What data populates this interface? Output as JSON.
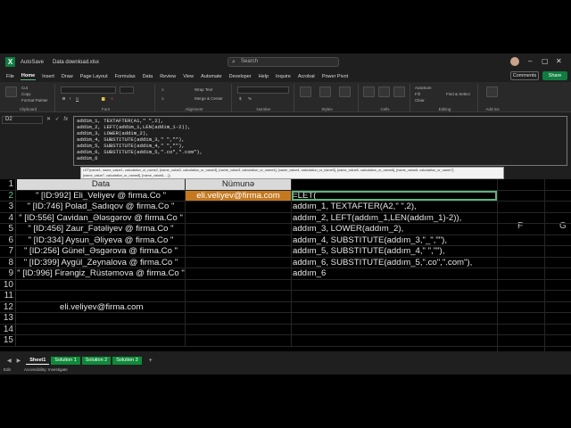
{
  "window": {
    "autosave": "AutoSave",
    "filename": "Data download.xlsx",
    "search_placeholder": "Search",
    "search_icon": "search-icon"
  },
  "menu": {
    "tabs": [
      "File",
      "Home",
      "Insert",
      "Draw",
      "Page Layout",
      "Formulas",
      "Data",
      "Review",
      "View",
      "Automate",
      "Developer",
      "Help",
      "Inquire",
      "Acrobat",
      "Power Pivot"
    ],
    "active": "Home",
    "comments_label": "Comments",
    "share_label": "Share"
  },
  "ribbon": {
    "clipboard": {
      "label": "Clipboard",
      "cut": "Cut",
      "copy": "Copy",
      "format_painter": "Format Painter"
    },
    "font": {
      "label": "Font"
    },
    "alignment": {
      "label": "Alignment",
      "wrap_text": "Wrap Text",
      "merge_center": "Merge & Center"
    },
    "number": {
      "label": "Number"
    },
    "styles": {
      "label": "Styles",
      "conditional": "Conditional Formatting",
      "format_table": "Format as Table",
      "cell_styles": "Cell Styles"
    },
    "cells": {
      "label": "Cells",
      "insert": "Insert",
      "delete": "Delete",
      "format": "Format"
    },
    "editing": {
      "label": "Editing",
      "autosum": "AutoSum",
      "fill": "Fill",
      "clear": "Clear",
      "sort": "Sort & Filter",
      "find": "Find & Select"
    },
    "addins": {
      "label": "Add-ins"
    }
  },
  "formula_bar": {
    "name_box": "D2",
    "formula_lines": [
      "addim_1, TEXTAFTER(A1,\" \",2),",
      "addim_2, LEFT(addim_1,LEN(addim_1-2)),",
      "addim_3, LOWER(addim_2),",
      "addim_4, SUBSTITUTE(addim_3,\" \",\"\"),",
      "addim_5, SUBSTITUTE(addim_4,\" \",\"\"),",
      "addim_6, SUBSTITUTE(addim_5,\".co\",\".com\"),",
      "addim_6"
    ],
    "tooltip_line1": "LET(name1, name_value1, calculation_or_name2, [name_value2, calculation_or_name3], [name_value3, calculation_or_name4], [name_value4, calculation_or_name5], [name_value5, calculation_or_name6], [name_value6, calculation_or_name7]",
    "tooltip_line2": "[name_value7, calculation_or_name8], [name_value8, ...])"
  },
  "grid": {
    "column_headers": {
      "F": "F",
      "G": "G"
    },
    "rows": [
      {
        "num": "1",
        "a": "Data",
        "b": "Nümunə",
        "c": ""
      },
      {
        "num": "2",
        "a": "\" [ID:992] Eli_Veliyev @ firma.Co \"",
        "b": "eli.veliyev@firma.com",
        "c": "=LET("
      },
      {
        "num": "3",
        "a": "\" [ID:746] Polad_Sadıqov @ firma.Co \"",
        "b": "",
        "c": "addım_1, TEXTAFTER(A2,\" \",2),"
      },
      {
        "num": "4",
        "a": "\" [ID:556] Cavidan_Ələsgərov @ firma.Co \"",
        "b": "",
        "c": "addım_2, LEFT(addım_1,LEN(addım_1)-2)),"
      },
      {
        "num": "5",
        "a": "\" [ID:456] Zaur_Fətəliyev @ firma.Co \"",
        "b": "",
        "c": "addım_3, LOWER(addım_2),"
      },
      {
        "num": "6",
        "a": "\" [ID:334] Aysun_Əliyeva @ firma.Co \"",
        "b": "",
        "c": "addım_4, SUBSTITUTE(addım_3,\"_\",\"\"),"
      },
      {
        "num": "7",
        "a": "\" [ID:256] Günel_Əsgərova @ firma.Co \"",
        "b": "",
        "c": "addım_5, SUBSTITUTE(addım_4,\" \",\"\"),"
      },
      {
        "num": "8",
        "a": "\" [ID:399] Aygül_Zeynalova @ firma.Co \"",
        "b": "",
        "c": "addım_6, SUBSTITUTE(addım_5,\".co\",\".com\"),"
      },
      {
        "num": "9",
        "a": "\" [ID:996] Firəngiz_Rüstəmova @ firma.Co \"",
        "b": "",
        "c": "addım_6"
      },
      {
        "num": "10",
        "a": "",
        "b": "",
        "c": ""
      },
      {
        "num": "11",
        "a": "",
        "b": "",
        "c": ""
      },
      {
        "num": "12",
        "a": "eli.veliyev@firma.com",
        "b": "",
        "c": ""
      },
      {
        "num": "13",
        "a": "",
        "b": "",
        "c": ""
      },
      {
        "num": "14",
        "a": "",
        "b": "",
        "c": ""
      },
      {
        "num": "15",
        "a": "",
        "b": "",
        "c": ""
      }
    ]
  },
  "sheets": {
    "tabs": [
      "Sheet1",
      "Solution 1",
      "Solution 2",
      "Solution 3"
    ],
    "active": "Sheet1",
    "add_label": "+"
  },
  "status": {
    "mode": "Edit",
    "accessibility": "Accessibility: Investigate"
  },
  "colors": {
    "accent": "#107c41",
    "sample_fill": "#c5791f",
    "header_fill": "#d9d9d9",
    "selection": "#5fb27e"
  }
}
